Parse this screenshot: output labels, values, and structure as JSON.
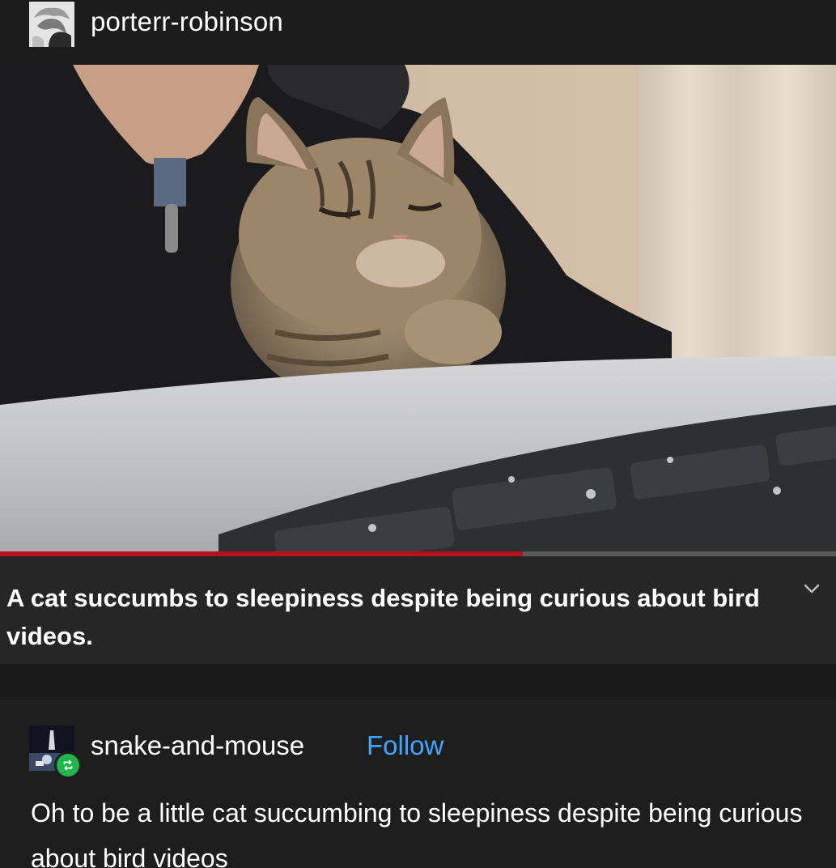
{
  "original_post": {
    "username": "porterr-robinson"
  },
  "video": {
    "progress_fraction": 0.625,
    "progress_color": "#b3121c",
    "caption": "A cat succumbs to sleepiness despite being curious about bird videos."
  },
  "reblog": {
    "username": "snake-and-mouse",
    "follow_label": "Follow",
    "text": "Oh to be a little cat succumbing to sleepiness despite being curious about bird videos",
    "reblog_badge_color": "#1fb74a"
  },
  "icons": {
    "caption_toggle": "chevron-down-icon",
    "reblog_badge": "reblog-icon"
  }
}
